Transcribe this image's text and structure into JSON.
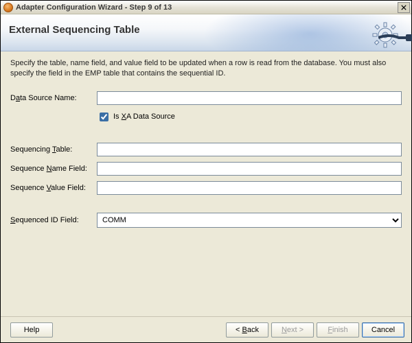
{
  "window": {
    "title": "Adapter Configuration Wizard - Step 9 of 13"
  },
  "banner": {
    "heading": "External Sequencing Table"
  },
  "instructions": "Specify the table, name field, and value field to be updated when a row is read from the database.  You must also specify the field in the EMP table that contains the sequential ID.",
  "form": {
    "data_source_name": {
      "label_pre": "D",
      "label_acc": "a",
      "label_post": "ta Source Name:",
      "value": ""
    },
    "is_xa": {
      "label_pre": "Is ",
      "label_acc": "X",
      "label_post": "A Data Source",
      "checked": true
    },
    "seq_table": {
      "label_pre": "Sequencing ",
      "label_acc": "T",
      "label_post": "able:",
      "value": ""
    },
    "seq_name_field": {
      "label_pre": "Sequence ",
      "label_acc": "N",
      "label_post": "ame Field:",
      "value": ""
    },
    "seq_value_field": {
      "label_pre": "Sequence ",
      "label_acc": "V",
      "label_post": "alue Field:",
      "value": ""
    },
    "seq_id_field": {
      "label_pre": "",
      "label_acc": "S",
      "label_post": "equenced ID Field:",
      "value": "COMM"
    }
  },
  "buttons": {
    "help": "Help",
    "back_pre": "< ",
    "back_acc": "B",
    "back_post": "ack",
    "next_pre": "",
    "next_acc": "N",
    "next_post": "ext >",
    "finish_pre": "",
    "finish_acc": "F",
    "finish_post": "inish",
    "cancel": "Cancel"
  }
}
